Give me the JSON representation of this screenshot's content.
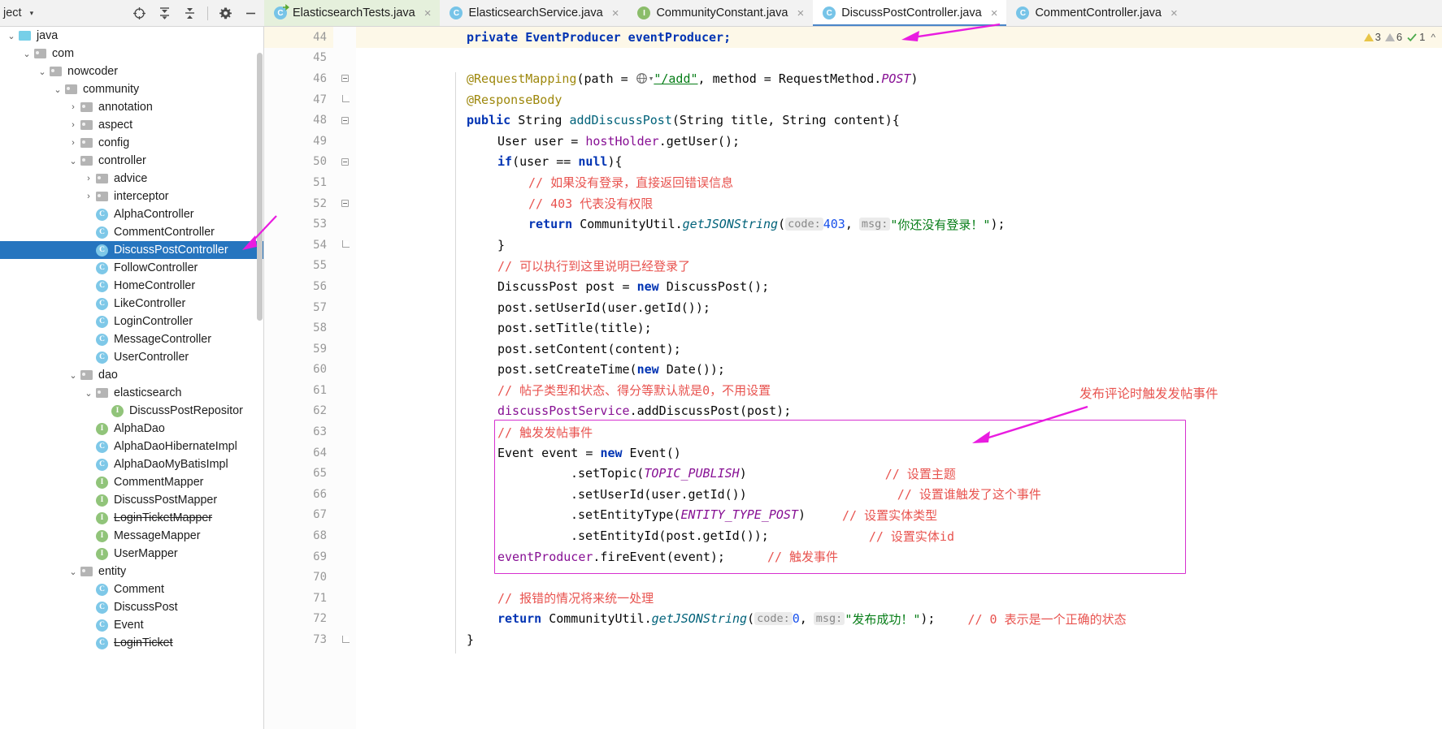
{
  "project_panel": {
    "title": "ject",
    "caret": "▾",
    "tools": [
      {
        "name": "locate-icon",
        "glyph": "locate"
      },
      {
        "name": "expand-all-icon",
        "glyph": "expand"
      },
      {
        "name": "collapse-all-icon",
        "glyph": "collapse"
      },
      {
        "name": "settings-gear-icon",
        "glyph": "gear"
      },
      {
        "name": "hide-panel-icon",
        "glyph": "minus"
      }
    ],
    "tree": [
      {
        "label": "java",
        "indent": 0,
        "arrow": "⌄",
        "icon": "folder-blue"
      },
      {
        "label": "com",
        "indent": 1,
        "arrow": "⌄",
        "icon": "folder"
      },
      {
        "label": "nowcoder",
        "indent": 2,
        "arrow": "⌄",
        "icon": "folder"
      },
      {
        "label": "community",
        "indent": 3,
        "arrow": "⌄",
        "icon": "folder"
      },
      {
        "label": "annotation",
        "indent": 4,
        "arrow": "›",
        "icon": "folder"
      },
      {
        "label": "aspect",
        "indent": 4,
        "arrow": "›",
        "icon": "folder"
      },
      {
        "label": "config",
        "indent": 4,
        "arrow": "›",
        "icon": "folder"
      },
      {
        "label": "controller",
        "indent": 4,
        "arrow": "⌄",
        "icon": "folder"
      },
      {
        "label": "advice",
        "indent": 5,
        "arrow": "›",
        "icon": "folder"
      },
      {
        "label": "interceptor",
        "indent": 5,
        "arrow": "›",
        "icon": "folder"
      },
      {
        "label": "AlphaController",
        "indent": 5,
        "arrow": "",
        "icon": "class"
      },
      {
        "label": "CommentController",
        "indent": 5,
        "arrow": "",
        "icon": "class"
      },
      {
        "label": "DiscussPostController",
        "indent": 5,
        "arrow": "",
        "icon": "class",
        "selected": true
      },
      {
        "label": "FollowController",
        "indent": 5,
        "arrow": "",
        "icon": "class"
      },
      {
        "label": "HomeController",
        "indent": 5,
        "arrow": "",
        "icon": "class"
      },
      {
        "label": "LikeController",
        "indent": 5,
        "arrow": "",
        "icon": "class"
      },
      {
        "label": "LoginController",
        "indent": 5,
        "arrow": "",
        "icon": "class"
      },
      {
        "label": "MessageController",
        "indent": 5,
        "arrow": "",
        "icon": "class"
      },
      {
        "label": "UserController",
        "indent": 5,
        "arrow": "",
        "icon": "class"
      },
      {
        "label": "dao",
        "indent": 4,
        "arrow": "⌄",
        "icon": "folder"
      },
      {
        "label": "elasticsearch",
        "indent": 5,
        "arrow": "⌄",
        "icon": "folder"
      },
      {
        "label": "DiscussPostRepositor",
        "indent": 6,
        "arrow": "",
        "icon": "interface"
      },
      {
        "label": "AlphaDao",
        "indent": 5,
        "arrow": "",
        "icon": "interface"
      },
      {
        "label": "AlphaDaoHibernateImpl",
        "indent": 5,
        "arrow": "",
        "icon": "class"
      },
      {
        "label": "AlphaDaoMyBatisImpl",
        "indent": 5,
        "arrow": "",
        "icon": "class"
      },
      {
        "label": "CommentMapper",
        "indent": 5,
        "arrow": "",
        "icon": "interface"
      },
      {
        "label": "DiscussPostMapper",
        "indent": 5,
        "arrow": "",
        "icon": "interface"
      },
      {
        "label": "LoginTicketMapper",
        "indent": 5,
        "arrow": "",
        "icon": "interface",
        "strike": true
      },
      {
        "label": "MessageMapper",
        "indent": 5,
        "arrow": "",
        "icon": "interface"
      },
      {
        "label": "UserMapper",
        "indent": 5,
        "arrow": "",
        "icon": "interface"
      },
      {
        "label": "entity",
        "indent": 4,
        "arrow": "⌄",
        "icon": "folder"
      },
      {
        "label": "Comment",
        "indent": 5,
        "arrow": "",
        "icon": "class"
      },
      {
        "label": "DiscussPost",
        "indent": 5,
        "arrow": "",
        "icon": "class"
      },
      {
        "label": "Event",
        "indent": 5,
        "arrow": "",
        "icon": "class"
      },
      {
        "label": "LoginTicket",
        "indent": 5,
        "arrow": "",
        "icon": "class",
        "strike": true
      }
    ]
  },
  "tabs": [
    {
      "label": "ElasticsearchTests.java",
      "icon": "class-test",
      "state": "green",
      "close": "×"
    },
    {
      "label": "ElasticsearchService.java",
      "icon": "class",
      "state": "normal",
      "close": "×"
    },
    {
      "label": "CommunityConstant.java",
      "icon": "interface",
      "state": "normal",
      "close": "×"
    },
    {
      "label": "DiscussPostController.java",
      "icon": "class",
      "state": "active",
      "close": "×"
    },
    {
      "label": "CommentController.java",
      "icon": "class",
      "state": "normal",
      "close": "×"
    }
  ],
  "inspection_status": {
    "warnings_yellow": "3",
    "warnings_grey": "6",
    "checks": "1"
  },
  "code": {
    "lines": [
      {
        "num": "44",
        "highlight": true,
        "gutter": "run-arrow",
        "fold": ""
      },
      {
        "num": "45",
        "highlight": false,
        "gutter": "",
        "fold": ""
      },
      {
        "num": "46",
        "highlight": false,
        "gutter": "",
        "fold": "minus"
      },
      {
        "num": "47",
        "highlight": false,
        "gutter": "",
        "fold": "end"
      },
      {
        "num": "48",
        "highlight": false,
        "gutter": "bean",
        "fold": "minus"
      },
      {
        "num": "49",
        "highlight": false,
        "gutter": "",
        "fold": ""
      },
      {
        "num": "50",
        "highlight": false,
        "gutter": "",
        "fold": "minus"
      },
      {
        "num": "51",
        "highlight": false,
        "gutter": "",
        "fold": ""
      },
      {
        "num": "52",
        "highlight": false,
        "gutter": "",
        "fold": "minus"
      },
      {
        "num": "53",
        "highlight": false,
        "gutter": "",
        "fold": ""
      },
      {
        "num": "54",
        "highlight": false,
        "gutter": "",
        "fold": "end"
      },
      {
        "num": "55",
        "highlight": false,
        "gutter": "",
        "fold": ""
      },
      {
        "num": "56",
        "highlight": false,
        "gutter": "",
        "fold": ""
      },
      {
        "num": "57",
        "highlight": false,
        "gutter": "",
        "fold": ""
      },
      {
        "num": "58",
        "highlight": false,
        "gutter": "",
        "fold": ""
      },
      {
        "num": "59",
        "highlight": false,
        "gutter": "",
        "fold": ""
      },
      {
        "num": "60",
        "highlight": false,
        "gutter": "",
        "fold": ""
      },
      {
        "num": "61",
        "highlight": false,
        "gutter": "",
        "fold": ""
      },
      {
        "num": "62",
        "highlight": false,
        "gutter": "",
        "fold": ""
      },
      {
        "num": "63",
        "highlight": false,
        "gutter": "",
        "fold": ""
      },
      {
        "num": "64",
        "highlight": false,
        "gutter": "",
        "fold": ""
      },
      {
        "num": "65",
        "highlight": false,
        "gutter": "",
        "fold": ""
      },
      {
        "num": "66",
        "highlight": false,
        "gutter": "",
        "fold": ""
      },
      {
        "num": "67",
        "highlight": false,
        "gutter": "",
        "fold": ""
      },
      {
        "num": "68",
        "highlight": false,
        "gutter": "",
        "fold": ""
      },
      {
        "num": "69",
        "highlight": false,
        "gutter": "",
        "fold": ""
      },
      {
        "num": "70",
        "highlight": false,
        "gutter": "",
        "fold": ""
      },
      {
        "num": "71",
        "highlight": false,
        "gutter": "",
        "fold": ""
      },
      {
        "num": "72",
        "highlight": false,
        "gutter": "",
        "fold": ""
      },
      {
        "num": "73",
        "highlight": false,
        "gutter": "",
        "fold": "end"
      }
    ],
    "text": {
      "l44": "private EventProducer eventProducer;",
      "l46_a": "@RequestMapping",
      "l46_b": "(path = ",
      "l46_url": "\"/add\"",
      "l46_c": ", method = RequestMethod.",
      "l46_d": "POST",
      "l46_e": ")",
      "l47": "@ResponseBody",
      "l48_kw": "public",
      "l48_type": " String ",
      "l48_fn": "addDiscussPost",
      "l48_rest": "(String title, String content){",
      "l49": "User user = hostHolder.getUser();",
      "l50_kw": "if",
      "l50_a": "(user == ",
      "l50_null": "null",
      "l50_b": "){",
      "l51": "// 如果没有登录，直接返回错误信息",
      "l52": "// 403 代表没有权限",
      "l53_kw": "return",
      "l53_cls": " CommunityUtil.",
      "l53_fn": "getJSONString",
      "l53_open": "(",
      "l53_hint1": "code:",
      "l53_num": "403",
      "l53_comma": ",",
      "l53_hint2": "msg:",
      "l53_str": "\"你还没有登录！\"",
      "l53_close": ");",
      "l54": "}",
      "l55": "// 可以执行到这里说明已经登录了",
      "l56_a": "DiscussPost post = ",
      "l56_kw": "new",
      "l56_b": " DiscussPost();",
      "l57": "post.setUserId(user.getId());",
      "l58": "post.setTitle(title);",
      "l59": "post.setContent(content);",
      "l60_a": "post.setCreateTime(",
      "l60_kw": "new",
      "l60_b": " Date());",
      "l61": "// 帖子类型和状态、得分等默认就是0，不用设置",
      "l62": "discussPostService.addDiscussPost(post);",
      "l63": "// 触发发帖事件",
      "l64_a": "Event event = ",
      "l64_kw": "new",
      "l64_b": " Event()",
      "l65_a": ".setTopic(",
      "l65_const": "TOPIC_PUBLISH",
      "l65_b": ")",
      "l65_cmt": "// 设置主题",
      "l66_a": ".setUserId(user.getId())",
      "l66_cmt": "// 设置谁触发了这个事件",
      "l67_a": ".setEntityType(",
      "l67_const": "ENTITY_TYPE_POST",
      "l67_b": ")",
      "l67_cmt": "// 设置实体类型",
      "l68_a": ".setEntityId(post.getId());",
      "l68_cmt": "// 设置实体id",
      "l69_a": "eventProducer",
      "l69_b": ".fireEvent(event);",
      "l69_cmt": "// 触发事件",
      "l71": "// 报错的情况将来统一处理",
      "l72_kw": "return",
      "l72_cls": " CommunityUtil.",
      "l72_fn": "getJSONString",
      "l72_open": "(",
      "l72_hint1": "code:",
      "l72_num": "0",
      "l72_comma": ",",
      "l72_hint2": "msg:",
      "l72_str": "\"发布成功！\"",
      "l72_close": ");",
      "l72_cmt": "// 0 表示是一个正确的状态",
      "l73": "}"
    }
  },
  "annotations": {
    "callout_text": "发布评论时触发发帖事件",
    "box_color": "#d630cf",
    "arrow_color": "#e91ce0"
  }
}
